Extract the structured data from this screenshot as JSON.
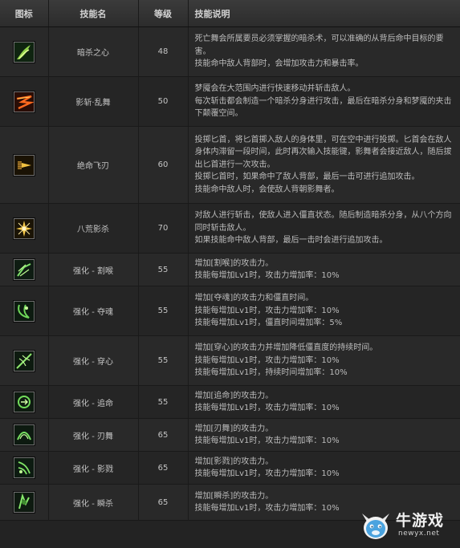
{
  "header": {
    "icon": "图标",
    "name": "技能名",
    "level": "等级",
    "desc": "技能说明"
  },
  "rows": [
    {
      "icon": "green-wing-strike-icon",
      "name": "暗杀之心",
      "level": "48",
      "desc": [
        "死亡舞会所属要员必须掌握的暗杀术，可以准确的从背后命中目标的要害。",
        "技能命中敌人背部时，会增加攻击力和暴击率。"
      ]
    },
    {
      "icon": "red-shadow-slash-icon",
      "name": "影斩·乱舞",
      "level": "50",
      "desc": [
        "梦魇会在大范围内进行快速移动并斩击敌人。",
        "每次斩击都会制造一个暗杀分身进行攻击，最后在暗杀分身和梦魇的夹击下颠覆空间。"
      ]
    },
    {
      "icon": "gold-flying-blade-icon",
      "name": "绝命飞刃",
      "level": "60",
      "desc": [
        "投掷匕首，将匕首掷入敌人的身体里，可在空中进行投掷。匕首会在敌人身体内滞留一段时间，此时再次输入技能键，影舞者会接近敌人，随后拔出匕首进行一次攻击。",
        "投掷匕首时，如果命中了敌人背部，最后一击可进行追加攻击。",
        "技能命中敌人时，会使敌人背朝影舞者。"
      ]
    },
    {
      "icon": "starburst-icon",
      "name": "八荒影杀",
      "level": "70",
      "desc": [
        "对敌人进行斩击，使敌人进入僵直状态。随后制造暗杀分身，从八个方向同时斩击敌人。",
        "如果技能命中敌人背部，最后一击时会进行追加攻击。"
      ]
    },
    {
      "icon": "green-claw-icon",
      "name": "强化 - 割喉",
      "level": "55",
      "desc": [
        "增加[割喉]的攻击力。",
        "技能每增加Lv1时，攻击力增加率：10%"
      ]
    },
    {
      "icon": "green-soul-icon",
      "name": "强化 - 夺魂",
      "level": "55",
      "desc": [
        "增加[夺魂]的攻击力和僵直时间。",
        "技能每增加Lv1时，攻击力增加率：10%",
        "技能每增加Lv1时，僵直时间增加率：5%"
      ]
    },
    {
      "icon": "green-pierce-icon",
      "name": "强化 - 穿心",
      "level": "55",
      "desc": [
        "增加[穿心]的攻击力并增加降低僵直度的持续时间。",
        "技能每增加Lv1时，攻击力增加率：10%",
        "技能每增加Lv1时，持续时间增加率：10%"
      ]
    },
    {
      "icon": "green-chase-icon",
      "name": "强化 - 追命",
      "level": "55",
      "desc": [
        "增加[追命]的攻击力。",
        "技能每增加Lv1时，攻击力增加率：10%"
      ]
    },
    {
      "icon": "green-blade-dance-icon",
      "name": "强化 - 刃舞",
      "level": "65",
      "desc": [
        "增加[刃舞]的攻击力。",
        "技能每增加Lv1时，攻击力增加率：10%"
      ]
    },
    {
      "icon": "green-shadow-icon",
      "name": "强化 - 影戮",
      "level": "65",
      "desc": [
        "增加[影戮]的攻击力。",
        "技能每增加Lv1时，攻击力增加率：10%"
      ]
    },
    {
      "icon": "green-instant-kill-icon",
      "name": "强化 - 瞬杀",
      "level": "65",
      "desc": [
        "增加[瞬杀]的攻击力。",
        "技能每增加Lv1时，攻击力增加率：10%"
      ]
    }
  ],
  "watermark": {
    "icon": "bull-logo-icon",
    "text": "牛游戏",
    "url": "newyx.net"
  }
}
